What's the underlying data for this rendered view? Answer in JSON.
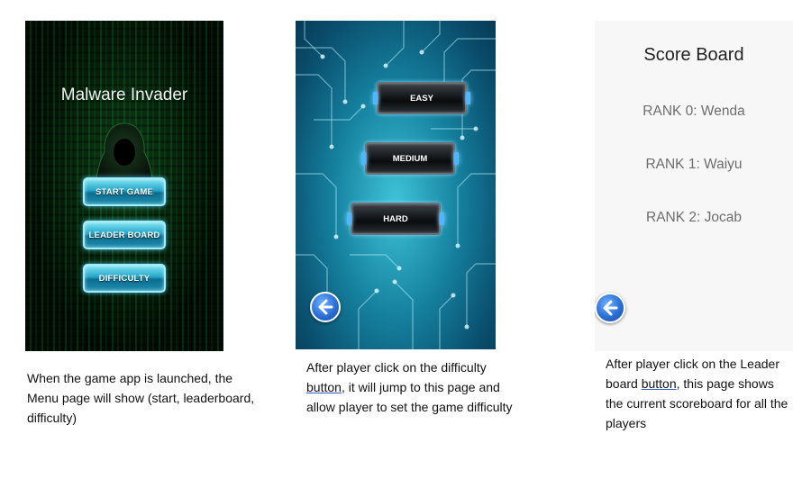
{
  "menu_screen": {
    "title": "Malware Invader",
    "buttons": {
      "start": "START GAME",
      "leaderboard": "LEADER BOARD",
      "difficulty": "DIFFICULTY"
    }
  },
  "difficulty_screen": {
    "buttons": {
      "easy": "EASY",
      "medium": "MEDIUM",
      "hard": "HARD"
    },
    "back_icon": "back-arrow-icon"
  },
  "scoreboard_screen": {
    "title": "Score Board",
    "ranks": [
      "RANK 0: Wenda",
      "RANK 1: Waiyu",
      "RANK 2: Jocab"
    ],
    "back_icon": "back-arrow-icon"
  },
  "captions": {
    "menu": "When the game app is launched, the Menu page will show (start, leaderboard, difficulty)",
    "difficulty_pre": "After player click on the difficulty ",
    "difficulty_link": "button",
    "difficulty_post": ", it will jump to this page and allow player to set the game difficulty",
    "scoreboard_pre": "After player click on the Leader board ",
    "scoreboard_link": "button",
    "scoreboard_post": ", this page shows the current scoreboard for all the players"
  },
  "colors": {
    "menu_button": "#23a5c8",
    "difficulty_bg": "#15819f",
    "back_button": "#2a6fd6"
  }
}
